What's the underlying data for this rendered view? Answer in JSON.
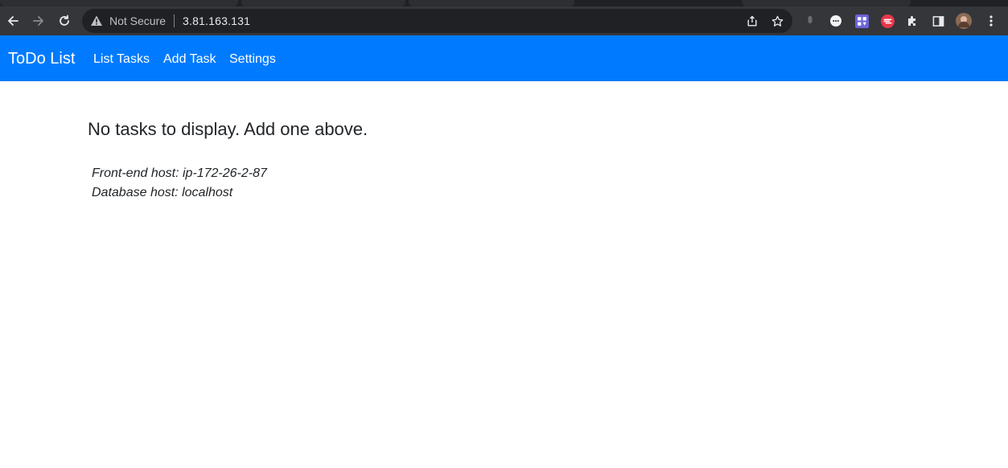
{
  "browser": {
    "security_label": "Not Secure",
    "url": "3.81.163.131",
    "icons": {
      "back": "arrow-left-icon",
      "forward": "arrow-right-icon",
      "reload": "reload-icon",
      "warning": "warning-icon",
      "share": "share-icon",
      "bookmark": "star-icon",
      "extensions": "puzzle-icon",
      "side_panel": "side-panel-icon",
      "menu": "kebab-menu-icon"
    },
    "colors": {
      "toolbar": "#35363a",
      "omnibox": "#202124",
      "text": "#e8eaed"
    }
  },
  "navbar": {
    "brand": "ToDo List",
    "links": [
      {
        "label": "List Tasks"
      },
      {
        "label": "Add Task"
      },
      {
        "label": "Settings"
      }
    ],
    "background": "#007bff"
  },
  "main": {
    "empty_message": "No tasks to display. Add one above.",
    "frontend_host": "Front-end host: ip-172-26-2-87",
    "database_host": "Database host: localhost"
  }
}
